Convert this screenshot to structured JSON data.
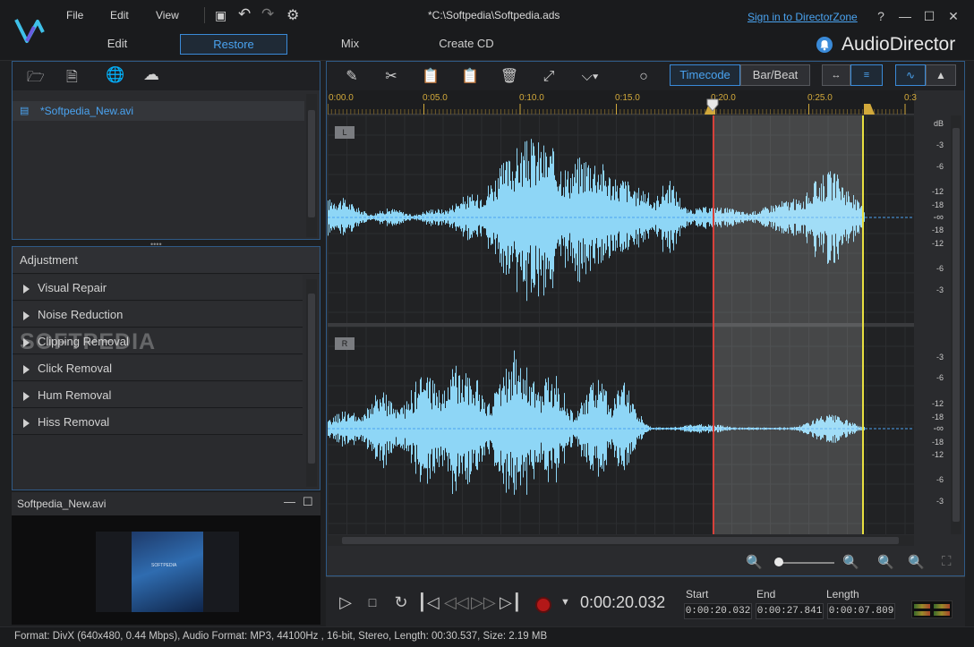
{
  "menu": {
    "file": "File",
    "edit": "Edit",
    "view": "View"
  },
  "title": "*C:\\Softpedia\\Softpedia.ads",
  "signin": "Sign in to DirectorZone",
  "help": "?",
  "app_name": "AudioDirector",
  "modes": [
    {
      "label": "Edit"
    },
    {
      "label": "Restore",
      "active": true
    },
    {
      "label": "Mix"
    },
    {
      "label": "Create CD"
    }
  ],
  "library": {
    "file_item": "*Softpedia_New.avi"
  },
  "adjustment": {
    "header": "Adjustment",
    "items": [
      "Visual Repair",
      "Noise Reduction",
      "Clipping Removal",
      "Click Removal",
      "Hum Removal",
      "Hiss Removal"
    ]
  },
  "preview": {
    "title": "Softpedia_New.avi",
    "thumb_text": "SOFTPEDIA"
  },
  "watermark": "SOFTPEDIA",
  "editor": {
    "timecode_label": "Timecode",
    "barbeat_label": "Bar/Beat",
    "ruler": [
      "0:00.0",
      "0:05.0",
      "0:10.0",
      "0:15.0",
      "0:20.0",
      "0:25.0",
      "0:3"
    ],
    "tracks": [
      {
        "label": "L",
        "db": [
          "dB",
          "-3",
          "-6",
          "-12",
          "-18",
          "-∞",
          "-18",
          "-12",
          "-6",
          "-3"
        ]
      },
      {
        "label": "R",
        "db": [
          "-3",
          "-6",
          "-12",
          "-18",
          "-∞",
          "-18",
          "-12",
          "-6",
          "-3"
        ]
      }
    ],
    "selection": {
      "start_sec": 20.032,
      "end_sec": 27.841
    },
    "total_sec": 30.537
  },
  "transport": {
    "current": "0:00:20.032",
    "start_label": "Start",
    "end_label": "End",
    "length_label": "Length",
    "start": "0:00:20.032",
    "end": "0:00:27.841",
    "length": "0:00:07.809"
  },
  "status": "Format: DivX (640x480, 0.44 Mbps), Audio Format: MP3, 44100Hz , 16-bit, Stereo, Length: 00:30.537, Size: 2.19 MB",
  "colors": {
    "accent": "#3a8ad8",
    "wave": "#8ed6f6",
    "ruler": "#d2a93b",
    "marker_start": "#d8413a",
    "marker_end": "#e8e040"
  }
}
